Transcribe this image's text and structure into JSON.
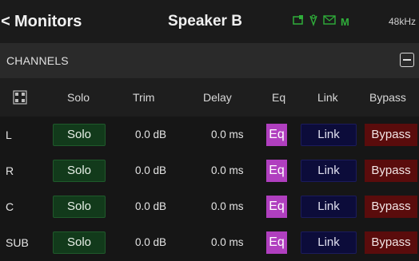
{
  "header": {
    "back_label": "Monitors",
    "back_chevron": "<",
    "title": "Speaker B",
    "sample_rate": "48kHz",
    "status_icons": [
      "network-icon",
      "mic-icon",
      "mail-icon"
    ],
    "status_letter": "M",
    "status_color": "#2fae3a"
  },
  "section": {
    "title": "CHANNELS",
    "collapse_icon": "collapse-icon"
  },
  "columns": {
    "select_icon": "grid-select-icon",
    "solo": "Solo",
    "trim": "Trim",
    "delay": "Delay",
    "eq": "Eq",
    "link": "Link",
    "bypass": "Bypass"
  },
  "rows": [
    {
      "label": "L",
      "solo": "Solo",
      "trim": "0.0 dB",
      "delay": "0.0 ms",
      "eq": "Eq",
      "link": "Link",
      "bypass": "Bypass"
    },
    {
      "label": "R",
      "solo": "Solo",
      "trim": "0.0 dB",
      "delay": "0.0 ms",
      "eq": "Eq",
      "link": "Link",
      "bypass": "Bypass"
    },
    {
      "label": "C",
      "solo": "Solo",
      "trim": "0.0 dB",
      "delay": "0.0 ms",
      "eq": "Eq",
      "link": "Link",
      "bypass": "Bypass"
    },
    {
      "label": "SUB",
      "solo": "Solo",
      "trim": "0.0 dB",
      "delay": "0.0 ms",
      "eq": "Eq",
      "link": "Link",
      "bypass": "Bypass"
    }
  ],
  "colors": {
    "solo": "#123a1b",
    "eq": "#b03fbf",
    "link": "#0c0c3a",
    "bypass": "#5a0c0c"
  }
}
